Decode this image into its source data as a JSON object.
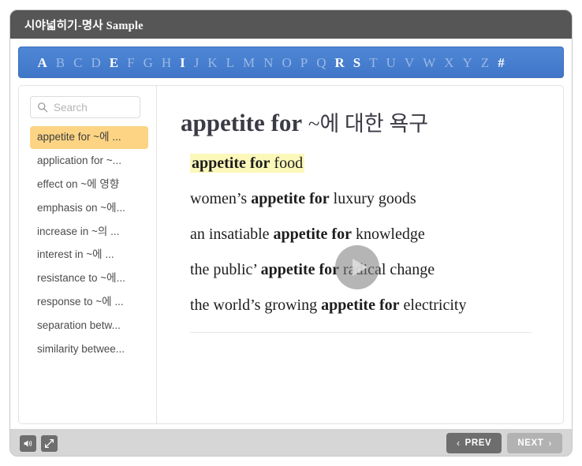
{
  "window": {
    "title": "시야넓히기-명사 Sample"
  },
  "alphabet_bar": {
    "letters": [
      {
        "label": "A",
        "active": true
      },
      {
        "label": "B",
        "active": false
      },
      {
        "label": "C",
        "active": false
      },
      {
        "label": "D",
        "active": false
      },
      {
        "label": "E",
        "active": true
      },
      {
        "label": "F",
        "active": false
      },
      {
        "label": "G",
        "active": false
      },
      {
        "label": "H",
        "active": false
      },
      {
        "label": "I",
        "active": true
      },
      {
        "label": "J",
        "active": false
      },
      {
        "label": "K",
        "active": false
      },
      {
        "label": "L",
        "active": false
      },
      {
        "label": "M",
        "active": false
      },
      {
        "label": "N",
        "active": false
      },
      {
        "label": "O",
        "active": false
      },
      {
        "label": "P",
        "active": false
      },
      {
        "label": "Q",
        "active": false
      },
      {
        "label": "R",
        "active": true
      },
      {
        "label": "S",
        "active": true
      },
      {
        "label": "T",
        "active": false
      },
      {
        "label": "U",
        "active": false
      },
      {
        "label": "V",
        "active": false
      },
      {
        "label": "W",
        "active": false
      },
      {
        "label": "X",
        "active": false
      },
      {
        "label": "Y",
        "active": false
      },
      {
        "label": "Z",
        "active": false
      },
      {
        "label": "#",
        "active": true
      }
    ]
  },
  "sidebar": {
    "search": {
      "placeholder": "Search",
      "value": "",
      "icon": "search-icon"
    },
    "items": [
      {
        "label": "appetite for ~에 ...",
        "selected": true
      },
      {
        "label": "application for ~...",
        "selected": false
      },
      {
        "label": "effect on ~에 영향",
        "selected": false
      },
      {
        "label": "emphasis on ~에...",
        "selected": false
      },
      {
        "label": "increase in ~의 ...",
        "selected": false
      },
      {
        "label": "interest in ~에 ...",
        "selected": false
      },
      {
        "label": "resistance to ~에...",
        "selected": false
      },
      {
        "label": "response to ~에 ...",
        "selected": false
      },
      {
        "label": "separation betw...",
        "selected": false
      },
      {
        "label": "similarity betwee...",
        "selected": false
      }
    ]
  },
  "main": {
    "headline": {
      "english": "appetite for",
      "korean": "~에 대한 욕구"
    },
    "examples": [
      {
        "highlighted": true,
        "parts": [
          {
            "text": "appetite for",
            "bold": true
          },
          {
            "text": " food",
            "bold": false
          }
        ]
      },
      {
        "highlighted": false,
        "parts": [
          {
            "text": "women’s ",
            "bold": false
          },
          {
            "text": "appetite for",
            "bold": true
          },
          {
            "text": " luxury goods",
            "bold": false
          }
        ]
      },
      {
        "highlighted": false,
        "parts": [
          {
            "text": "an insatiable ",
            "bold": false
          },
          {
            "text": "appetite for",
            "bold": true
          },
          {
            "text": " knowledge",
            "bold": false
          }
        ]
      },
      {
        "highlighted": false,
        "parts": [
          {
            "text": "the public’ ",
            "bold": false
          },
          {
            "text": "appetite for",
            "bold": true
          },
          {
            "text": " radical change",
            "bold": false
          }
        ]
      },
      {
        "highlighted": false,
        "parts": [
          {
            "text": "the world’s growing ",
            "bold": false
          },
          {
            "text": "appetite for",
            "bold": true
          },
          {
            "text": " electricity",
            "bold": false
          }
        ]
      }
    ],
    "play_button": {
      "icon": "play-icon"
    }
  },
  "bottom_bar": {
    "tools": [
      {
        "icon": "volume-icon",
        "name": "volume-button"
      },
      {
        "icon": "expand-icon",
        "name": "fullscreen-button"
      }
    ],
    "prev": {
      "label": "PREV",
      "chevron": "‹",
      "enabled": true
    },
    "next": {
      "label": "NEXT",
      "chevron": "›",
      "enabled": false
    }
  },
  "colors": {
    "title_bar": "#565656",
    "alphabet_bar": "#4076c8",
    "selected_item": "#fcd484",
    "highlight": "#fbf8ba",
    "prev_button": "#6e6e6e",
    "next_button": "#b2b2b2"
  }
}
